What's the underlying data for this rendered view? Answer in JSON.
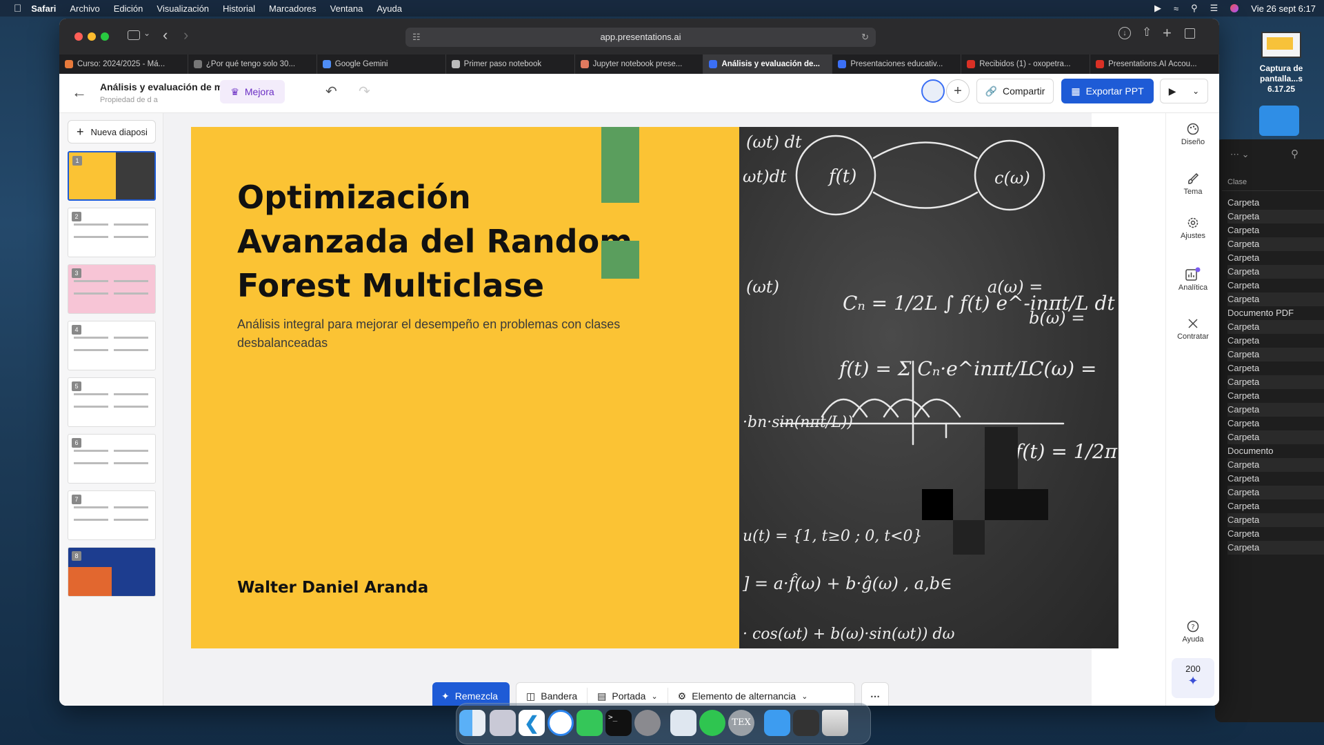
{
  "menubar": {
    "app": "Safari",
    "items": [
      "Archivo",
      "Edición",
      "Visualización",
      "Historial",
      "Marcadores",
      "Ventana",
      "Ayuda"
    ],
    "datetime": "Vie 26 sept 6:17"
  },
  "desktop": {
    "screenshot_label": "Captura de pantalla...s 6.17.25"
  },
  "browser": {
    "url": "app.presentations.ai",
    "tabs": [
      {
        "label": "Curso: 2024/2025 - Má...",
        "color": "#e87a3b",
        "active": false
      },
      {
        "label": "¿Por qué tengo solo 30...",
        "color": "#777777",
        "active": false
      },
      {
        "label": "Google Gemini",
        "color": "#4f8ef7",
        "active": false
      },
      {
        "label": "Primer paso notebook",
        "color": "#bbbbbb",
        "active": false
      },
      {
        "label": "Jupyter notebook prese...",
        "color": "#e07a5f",
        "active": false
      },
      {
        "label": "Análisis y evaluación de...",
        "color": "#3b6ff5",
        "active": true
      },
      {
        "label": "Presentaciones educativ...",
        "color": "#3b6ff5",
        "active": false
      },
      {
        "label": "Recibidos (1) - oxopetra...",
        "color": "#d93025",
        "active": false
      },
      {
        "label": "Presentations.AI Accou...",
        "color": "#d93025",
        "active": false
      }
    ]
  },
  "header": {
    "doc_title": "Análisis y evaluación de mét...",
    "doc_owner": "Propiedad de d a",
    "upgrade_label": "Mejora",
    "share_label": "Compartir",
    "export_label": "Exportar PPT"
  },
  "left_panel": {
    "new_slide_label": "Nueva diaposi",
    "slides": [
      {
        "num": "1",
        "bg": "#fbc334"
      },
      {
        "num": "2",
        "bg": "#ffffff"
      },
      {
        "num": "3",
        "bg": "#f7c5d6"
      },
      {
        "num": "4",
        "bg": "#ffffff"
      },
      {
        "num": "5",
        "bg": "#ffffff"
      },
      {
        "num": "6",
        "bg": "#ffffff"
      },
      {
        "num": "7",
        "bg": "#ffffff"
      },
      {
        "num": "8",
        "bg": "#1d3d8f"
      }
    ]
  },
  "slide": {
    "title": "Optimización Avanzada del Random Forest Multiclase",
    "subtitle": "Análisis integral para mejorar el desempeño en problemas con clases desbalanceadas",
    "author": "Walter Daniel Aranda"
  },
  "bottom_toolbar": {
    "remix_label": "Remezcla",
    "flag_label": "Bandera",
    "cover_label": "Portada",
    "toggle_label": "Elemento de alternancia"
  },
  "right_rail": {
    "items": [
      "Diseño",
      "Tema",
      "Ajustes",
      "Analítica",
      "Contratar"
    ],
    "help_label": "Ayuda",
    "credits": "200"
  },
  "finder": {
    "column_header": "Clase",
    "rows": [
      "Carpeta",
      "Carpeta",
      "Carpeta",
      "Carpeta",
      "Carpeta",
      "Carpeta",
      "Carpeta",
      "Carpeta",
      "Documento PDF",
      "Carpeta",
      "Carpeta",
      "Carpeta",
      "Carpeta",
      "Carpeta",
      "Carpeta",
      "Carpeta",
      "Carpeta",
      "Carpeta",
      "Documento",
      "Carpeta",
      "Carpeta",
      "Carpeta",
      "Carpeta",
      "Carpeta",
      "Carpeta",
      "Carpeta"
    ]
  }
}
